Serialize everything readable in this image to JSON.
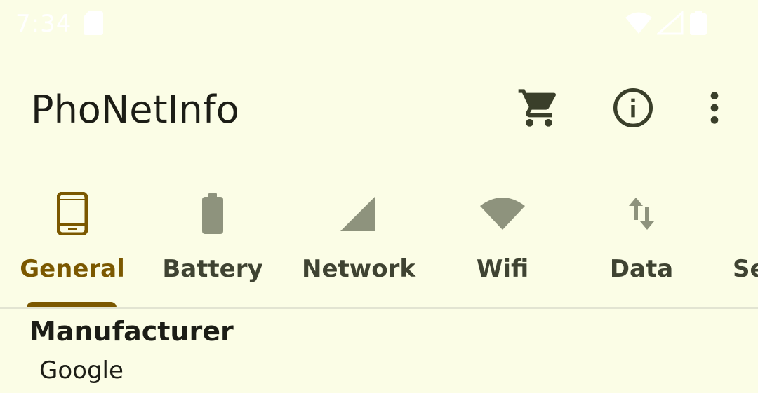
{
  "status_bar": {
    "time": "7:34",
    "icons": [
      "sd-card-icon",
      "wifi-icon",
      "signal-icon",
      "battery-icon"
    ]
  },
  "app_bar": {
    "title": "PhoNetInfo",
    "actions": [
      "cart-icon",
      "info-icon",
      "more-vert-icon"
    ]
  },
  "tabs": [
    {
      "label": "General",
      "icon": "phone-icon",
      "active": true
    },
    {
      "label": "Battery",
      "icon": "battery-icon",
      "active": false
    },
    {
      "label": "Network",
      "icon": "signal-icon",
      "active": false
    },
    {
      "label": "Wifi",
      "icon": "wifi-icon",
      "active": false
    },
    {
      "label": "Data",
      "icon": "data-arrows-icon",
      "active": false
    },
    {
      "label": "Se",
      "icon": "",
      "active": false
    }
  ],
  "content": {
    "items": [
      {
        "label": "Manufacturer",
        "value": "Google"
      }
    ]
  },
  "colors": {
    "background": "#FBFDE6",
    "accent": "#7B5800",
    "icon_inactive": "#8E937D",
    "text": "#1C1D16",
    "tab_text": "#3F4332"
  }
}
